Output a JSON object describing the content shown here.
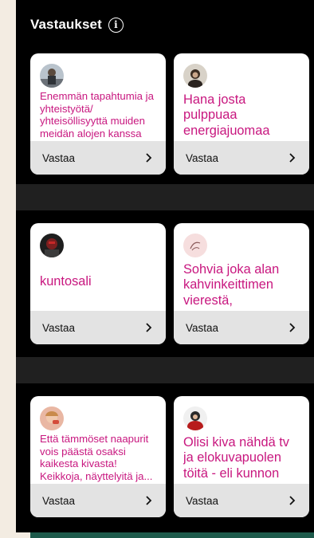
{
  "header": {
    "title": "Vastaukset",
    "info_icon": "info-icon"
  },
  "colors": {
    "accent_text": "#c8177f",
    "footer_bg": "#e3e3e3",
    "band": "#202020",
    "bottom_bar": "#1d5a4b"
  },
  "cards": [
    {
      "text": "Enemmän tapahtumia ja yhteistyötä/ yhteisöllisyyttä muiden meidän alojen kanssa",
      "action": "Vastaa"
    },
    {
      "text": "Hana josta pulppuaa energiajuomaa",
      "action": "Vastaa"
    },
    {
      "text": "kuntosali",
      "action": "Vastaa"
    },
    {
      "text": "Sohvia joka alan kahvinkeittimen vierestä, hierontatuoli, sähköpöytiä",
      "action": "Vastaa"
    },
    {
      "text": "Että tämmöset naapurit vois päästä osaksi kaikesta kivasta! Keikkoja, näyttelyitä ja...",
      "action": "Vastaa"
    },
    {
      "text": "Olisi kiva nähdä tv ja elokuvapuolen töitä - eli kunnon leffateatteri!",
      "action": "Vastaa"
    }
  ]
}
